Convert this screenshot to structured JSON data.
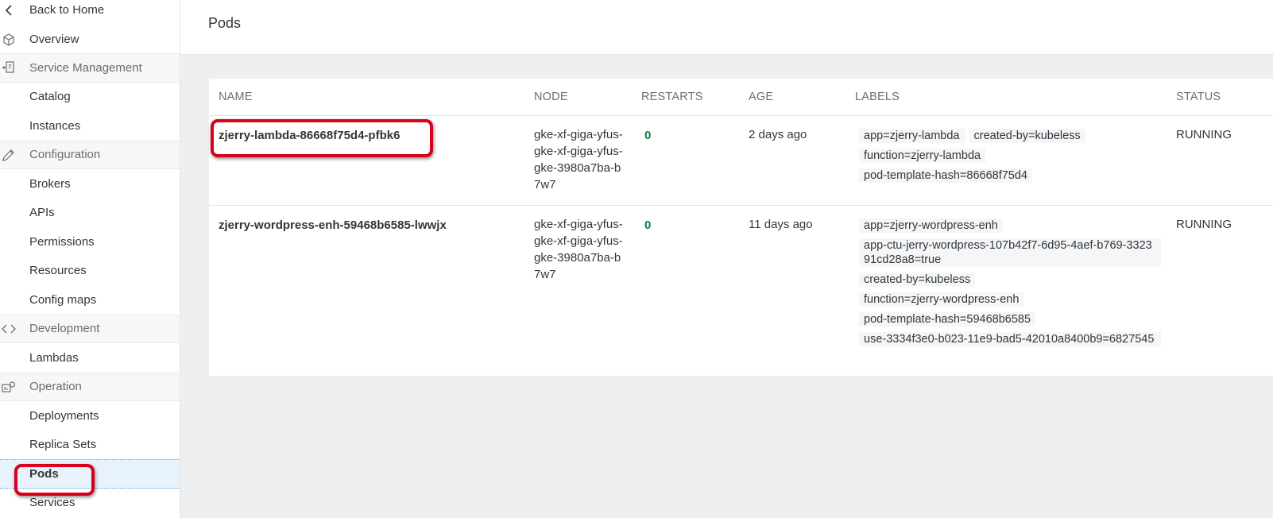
{
  "sidebar": {
    "back": "Back to Home",
    "overview": "Overview",
    "service_management": "Service Management",
    "catalog": "Catalog",
    "instances": "Instances",
    "configuration": "Configuration",
    "brokers": "Brokers",
    "apis": "APIs",
    "permissions": "Permissions",
    "resources": "Resources",
    "config_maps": "Config maps",
    "development": "Development",
    "lambdas": "Lambdas",
    "operation": "Operation",
    "deployments": "Deployments",
    "replica_sets": "Replica Sets",
    "pods": "Pods",
    "services": "Services"
  },
  "header": {
    "title": "Pods"
  },
  "table": {
    "columns": {
      "name": "NAME",
      "node": "NODE",
      "restarts": "RESTARTS",
      "age": "AGE",
      "labels": "LABELS",
      "status": "STATUS"
    },
    "rows": [
      {
        "name": "zjerry-lambda-86668f75d4-pfbk6",
        "node_lines": [
          "gke-xf-giga-yfus-",
          "gke-xf-giga-yfus-",
          "gke-3980a7ba-b",
          "7w7"
        ],
        "restarts": "0",
        "age": "2 days ago",
        "labels": [
          "app=zjerry-lambda",
          "created-by=kubeless",
          "function=zjerry-lambda",
          "pod-template-hash=86668f75d4"
        ],
        "status": "RUNNING"
      },
      {
        "name": "zjerry-wordpress-enh-59468b6585-lwwjx",
        "node_lines": [
          "gke-xf-giga-yfus-",
          "gke-xf-giga-yfus-",
          "gke-3980a7ba-b",
          "7w7"
        ],
        "restarts": "0",
        "age": "11 days ago",
        "labels": [
          "app=zjerry-wordpress-enh",
          "app-ctu-jerry-wordpress-107b42f7-6d95-4aef-b769-332391cd28a8=true",
          "created-by=kubeless",
          "function=zjerry-wordpress-enh",
          "pod-template-hash=59468b6585",
          "use-3334f3e0-b023-11e9-bad5-42010a8400b9=6827545"
        ],
        "status": "RUNNING"
      }
    ]
  },
  "colors": {
    "accent": "#0a6ed1",
    "highlight": "#d8001c",
    "restarts_ok": "#107e3e"
  }
}
